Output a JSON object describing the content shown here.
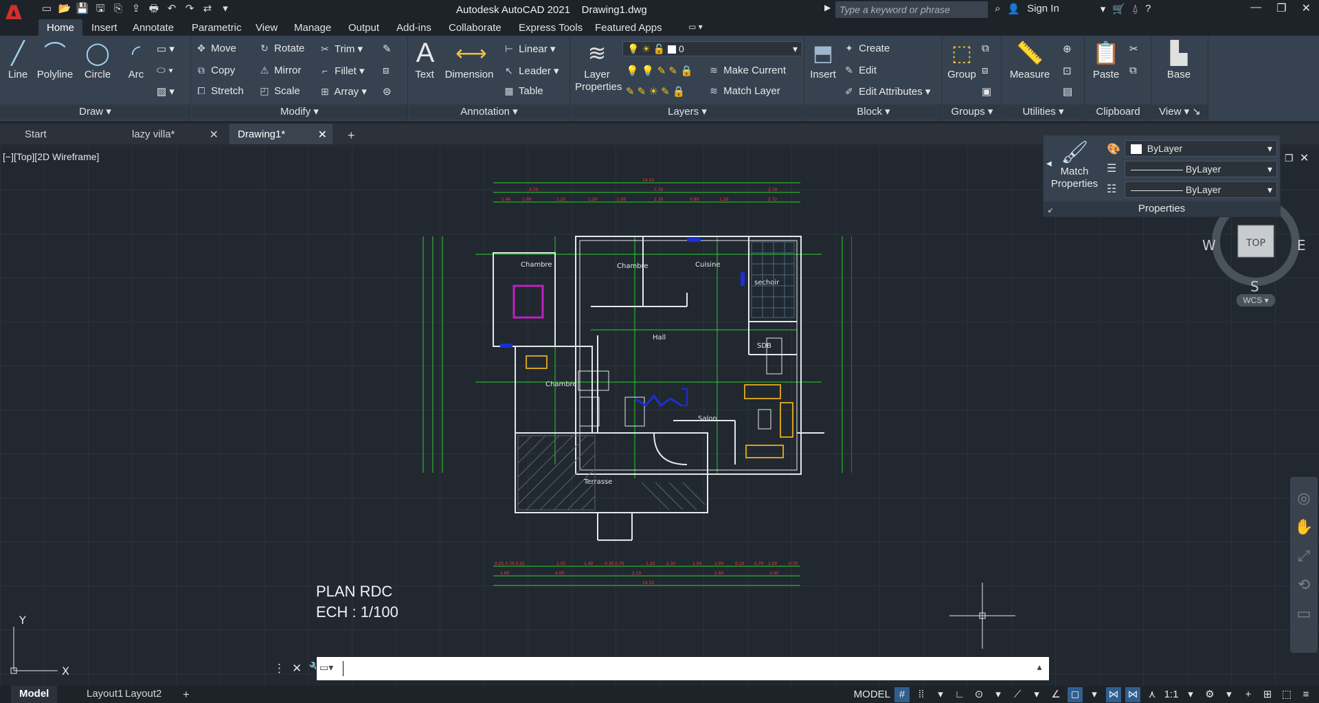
{
  "titlebar": {
    "app_name": "Autodesk AutoCAD 2021",
    "file_name": "Drawing1.dwg",
    "search_placeholder": "Type a keyword or phrase",
    "sign_in": "Sign In"
  },
  "menu": {
    "tabs": [
      "Home",
      "Insert",
      "Annotate",
      "Parametric",
      "View",
      "Manage",
      "Output",
      "Add-ins",
      "Collaborate",
      "Express Tools",
      "Featured Apps"
    ],
    "active": "Home"
  },
  "ribbon": {
    "draw": {
      "title": "Draw",
      "line": "Line",
      "polyline": "Polyline",
      "circle": "Circle",
      "arc": "Arc"
    },
    "modify": {
      "title": "Modify",
      "move": "Move",
      "rotate": "Rotate",
      "trim": "Trim",
      "copy": "Copy",
      "mirror": "Mirror",
      "fillet": "Fillet",
      "stretch": "Stretch",
      "scale": "Scale",
      "array": "Array"
    },
    "annotation": {
      "title": "Annotation",
      "text": "Text",
      "dimension": "Dimension",
      "linear": "Linear",
      "leader": "Leader",
      "table": "Table"
    },
    "layers": {
      "title": "Layers",
      "layer_properties": "Layer Properties",
      "current_layer": "0",
      "make_current": "Make Current",
      "match_layer": "Match Layer"
    },
    "block": {
      "title": "Block",
      "insert": "Insert",
      "create": "Create",
      "edit": "Edit",
      "edit_attributes": "Edit Attributes"
    },
    "groups": {
      "title": "Groups",
      "group": "Group"
    },
    "utilities": {
      "title": "Utilities",
      "measure": "Measure"
    },
    "clipboard": {
      "title": "Clipboard",
      "paste": "Paste"
    },
    "view": {
      "title": "View",
      "base": "Base"
    }
  },
  "file_tabs": [
    "Start",
    "lazy villa*",
    "Drawing1*"
  ],
  "viewport": {
    "label": "[−][Top][2D Wireframe]",
    "drawing_title": "PLAN RDC",
    "drawing_scale": "ECH : 1/100",
    "rooms": [
      "Chambre",
      "Chambre",
      "Cuisine",
      "sechoir",
      "Hall",
      "SDB",
      "Chambre",
      "Salon",
      "Terrasse"
    ]
  },
  "properties_panel": {
    "match_properties": "Match Properties",
    "title": "Properties",
    "color": "ByLayer",
    "lineweight": "ByLayer",
    "linetype": "ByLayer"
  },
  "viewcube": {
    "top": "TOP",
    "west": "W",
    "east": "E",
    "south": "S",
    "wcs": "WCS"
  },
  "ucs": {
    "x": "X",
    "y": "Y"
  },
  "layout_tabs": [
    "Model",
    "Layout1",
    "Layout2"
  ],
  "status": {
    "model": "MODEL",
    "scale": "1:1"
  },
  "colors": {
    "canvas": "#212830",
    "ribbon": "#364250",
    "dim_green": "#27d327",
    "dim_red": "#ff3b3b",
    "wall": "#e6e8ea",
    "accent_magenta": "#c020c0",
    "accent_blue": "#1a2fd6"
  }
}
